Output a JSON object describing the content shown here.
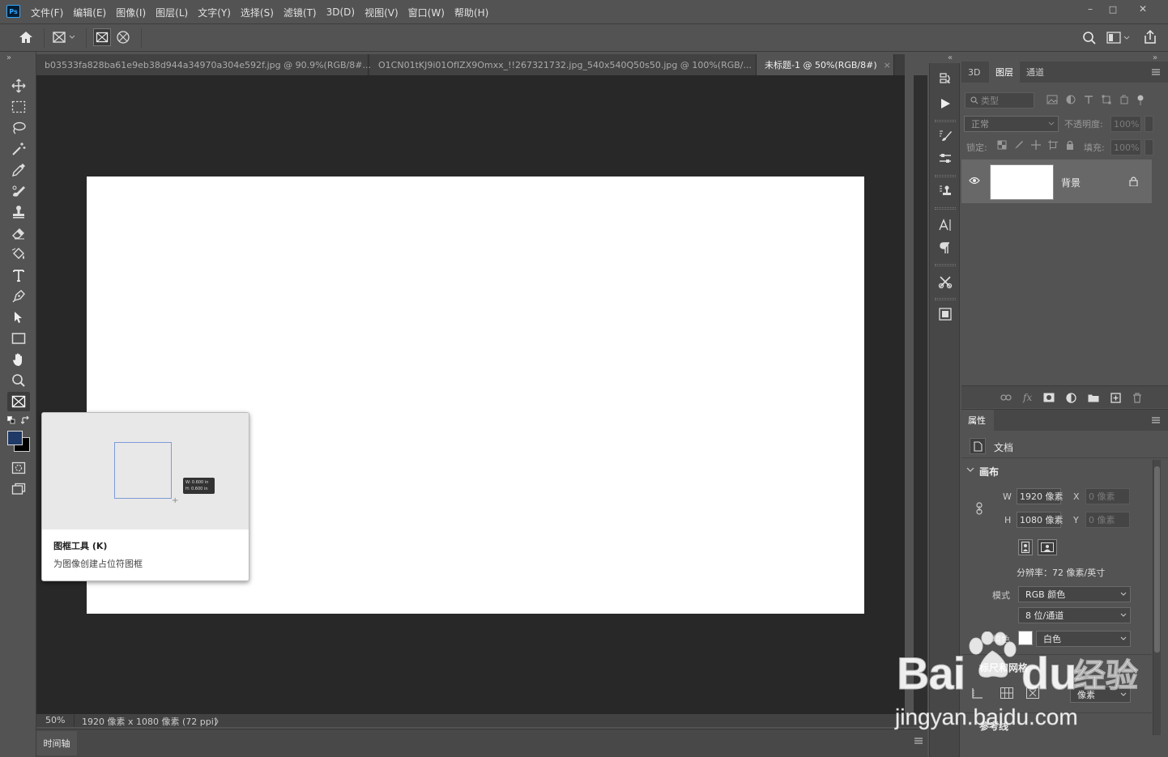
{
  "app": {
    "logo": "Ps",
    "accent": "#31a8ff"
  },
  "menubar": {
    "items": [
      "文件(F)",
      "编辑(E)",
      "图像(I)",
      "图层(L)",
      "文字(Y)",
      "选择(S)",
      "滤镜(T)",
      "3D(D)",
      "视图(V)",
      "窗口(W)",
      "帮助(H)"
    ]
  },
  "window_controls": {
    "minimize": "–",
    "maximize": "□",
    "close": "✕"
  },
  "doc_tabs": [
    {
      "label": "b03533fa828ba61e9eb38d944a34970a304e592f.jpg @ 90.9%(RGB/8#...",
      "close": "×"
    },
    {
      "label": "O1CN01tKJ9i01OfIZX9Omxx_!!267321732.jpg_540x540Q50s50.jpg @ 100%(RGB/...",
      "close": "×"
    },
    {
      "label": "未标题-1 @ 50%(RGB/8#)",
      "close": "×"
    }
  ],
  "collapse_left": "»",
  "collapse_right": "»",
  "dock_collapse": "«",
  "status": {
    "zoom": "50%",
    "info": "1920 像素 x 1080 像素 (72 ppi)",
    "arrow": "〉"
  },
  "timeline": {
    "label": "时间轴"
  },
  "layers": {
    "tabs": [
      "3D",
      "图层",
      "通道"
    ],
    "filter_placeholder": "类型",
    "blend_mode": "正常",
    "opacity_label": "不透明度:",
    "opacity_value": "100%",
    "lock_label": "锁定:",
    "fill_label": "填充:",
    "fill_value": "100%",
    "layer_name": "背景"
  },
  "properties": {
    "tab": "属性",
    "doc_label": "文档",
    "section_canvas": "画布",
    "w_label": "W",
    "w_value": "1920 像素",
    "h_label": "H",
    "h_value": "1080 像素",
    "x_label": "X",
    "x_value": "0 像素",
    "y_label": "Y",
    "y_value": "0 像素",
    "resolution": "分辨率：72 像素/英寸",
    "mode_label": "模式",
    "mode_value": "RGB 颜色",
    "depth_value": "8 位/通道",
    "fill_label": "填色",
    "fill_value": "白色",
    "section_rulers": "标尺和网格",
    "ruler_unit": "像素",
    "section_guides": "参考线"
  },
  "tooltip": {
    "title": "图框工具 (K)",
    "desc": "为图像创建占位符图框",
    "badge_w": "W: 0.600 in",
    "badge_h": "H: 0.600 in"
  },
  "watermark": {
    "brand": "Bai",
    "brand2": "du",
    "cn": "经验",
    "url": "jingyan.baidu.com"
  },
  "colors": {
    "canvas_bg": "#282828",
    "doc": "#ffffff",
    "fg_swatch": "#1f3a66",
    "bg_swatch": "#000000"
  }
}
